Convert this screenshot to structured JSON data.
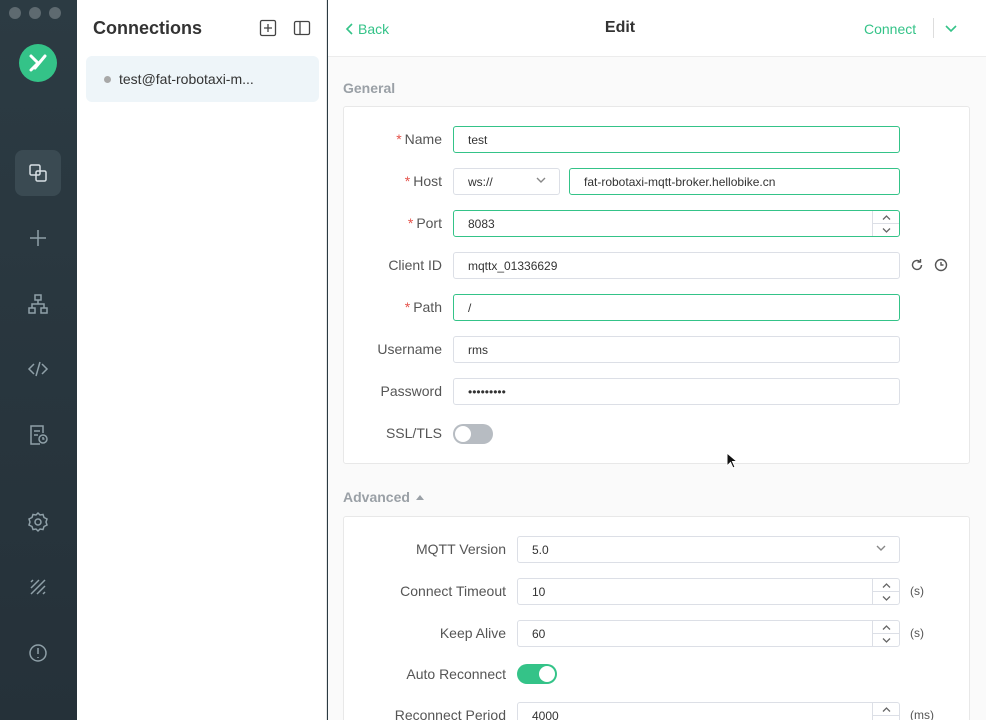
{
  "window": {
    "traffic_lights": [
      "close",
      "minimize",
      "maximize"
    ]
  },
  "rail": {
    "items": [
      {
        "icon": "connections-icon",
        "active": true
      },
      {
        "icon": "plus-icon"
      },
      {
        "icon": "topology-icon"
      },
      {
        "icon": "code-icon"
      },
      {
        "icon": "log-icon"
      },
      {
        "icon": "gear-icon"
      },
      {
        "icon": "rss-icon"
      },
      {
        "icon": "info-icon"
      }
    ]
  },
  "connections": {
    "title": "Connections",
    "items": [
      {
        "label": "test@fat-robotaxi-m...",
        "status": "offline"
      }
    ]
  },
  "topbar": {
    "back_label": "Back",
    "title": "Edit",
    "connect_label": "Connect"
  },
  "general": {
    "section_label": "General",
    "name": {
      "label": "Name",
      "value": "test"
    },
    "host": {
      "label": "Host",
      "protocol": "ws://",
      "value": "fat-robotaxi-mqtt-broker.hellobike.cn"
    },
    "port": {
      "label": "Port",
      "value": "8083"
    },
    "client_id": {
      "label": "Client ID",
      "value": "mqttx_01336629"
    },
    "path": {
      "label": "Path",
      "value": "/"
    },
    "username": {
      "label": "Username",
      "value": "rms"
    },
    "password": {
      "label": "Password",
      "value": "•••••••••"
    },
    "ssl": {
      "label": "SSL/TLS",
      "enabled": false
    }
  },
  "advanced": {
    "section_label": "Advanced",
    "mqtt_version": {
      "label": "MQTT Version",
      "value": "5.0"
    },
    "connect_timeout": {
      "label": "Connect Timeout",
      "value": "10",
      "unit": "(s)"
    },
    "keep_alive": {
      "label": "Keep Alive",
      "value": "60",
      "unit": "(s)"
    },
    "auto_reconnect": {
      "label": "Auto Reconnect",
      "enabled": true
    },
    "reconnect_period": {
      "label": "Reconnect Period",
      "value": "4000",
      "unit": "(ms)"
    }
  },
  "colors": {
    "accent": "#34c388",
    "rail": "#2c3b43",
    "required": "#e5534b"
  }
}
